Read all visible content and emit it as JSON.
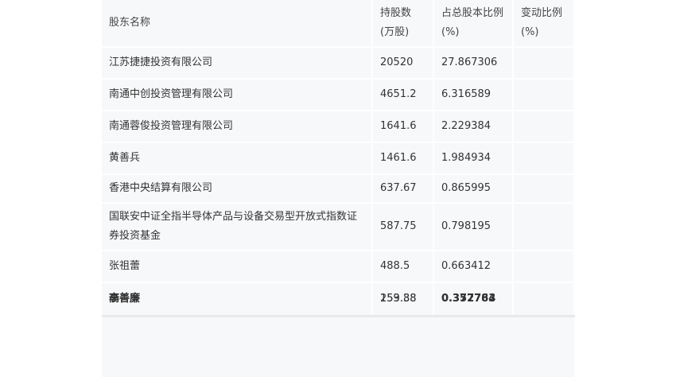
{
  "table": {
    "headers": [
      "股东名称",
      "持股数(万股)",
      "占总股本比例(%)",
      "变动比例(%)"
    ],
    "rows": [
      {
        "name": "江苏捷捷投资有限公司",
        "shares": "20520",
        "ratio": "27.867306",
        "change": ""
      },
      {
        "name": "南通中创投资管理有限公司",
        "shares": "4651.2",
        "ratio": "6.316589",
        "change": ""
      },
      {
        "name": "南通蓉俊投资管理有限公司",
        "shares": "1641.6",
        "ratio": "2.229384",
        "change": ""
      },
      {
        "name": "黄善兵",
        "shares": "1461.6",
        "ratio": "1.984934",
        "change": ""
      },
      {
        "name": "香港中央结算有限公司",
        "shares": "637.67",
        "ratio": "0.865995",
        "change": ""
      },
      {
        "name": "国联安中证全指半导体产品与设备交易型开放式指数证券投资基金",
        "shares": "587.75",
        "ratio": "0.798195",
        "change": ""
      },
      {
        "name": "张祖蕾",
        "shares": "488.5",
        "ratio": "0.663412",
        "change": ""
      }
    ],
    "last_row": {
      "name_a": "高善廉",
      "name_b": "李善廉",
      "shares_a": "259.88",
      "shares_b": "153.38",
      "ratio_a": "0.352783",
      "ratio_b": "0.377764",
      "change": ""
    }
  }
}
